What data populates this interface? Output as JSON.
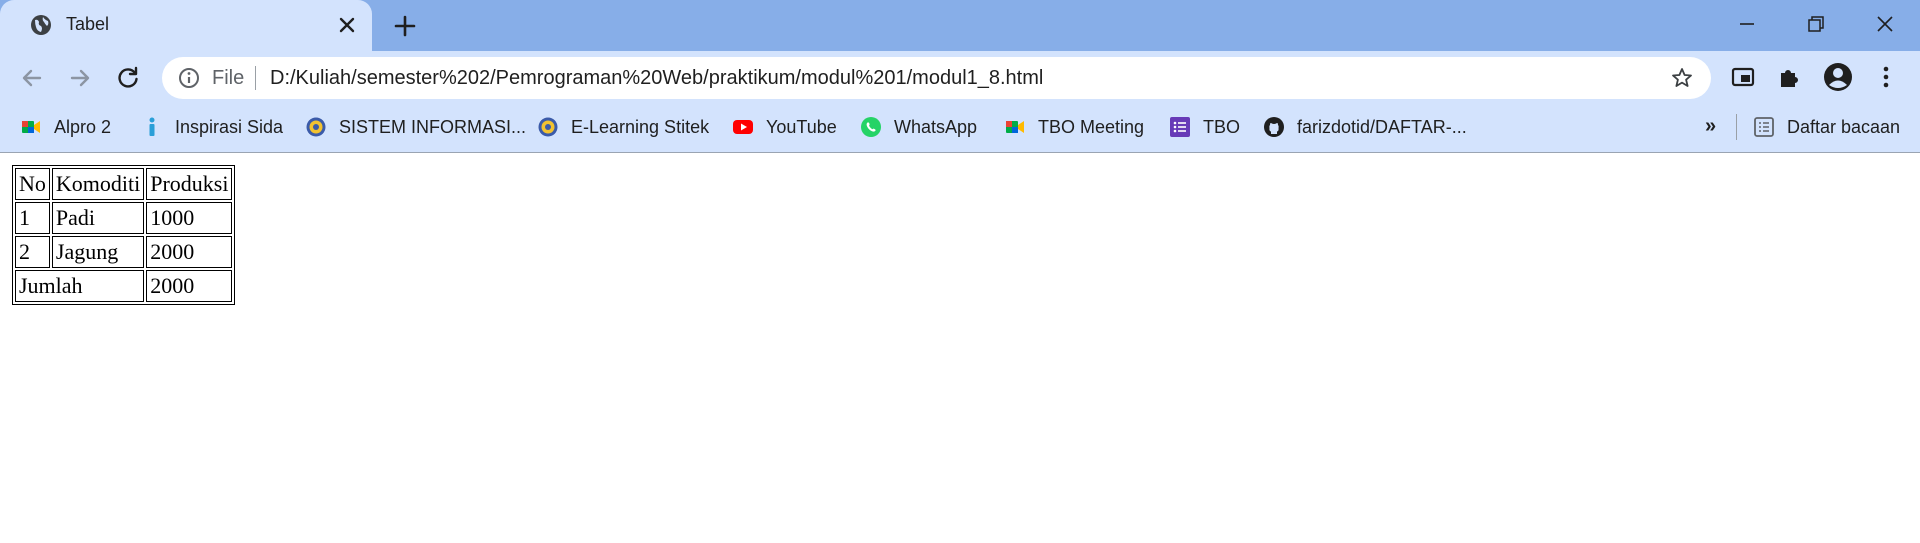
{
  "tab": {
    "title": "Tabel"
  },
  "toolbar": {
    "scheme_label": "File",
    "url": "D:/Kuliah/semester%202/Pemrograman%20Web/praktikum/modul%201/modul1_8.html"
  },
  "bookmarks": {
    "items": [
      {
        "label": "Alpro 2",
        "icon": "google-meet-icon"
      },
      {
        "label": "Inspirasi Sida",
        "icon": "info-figure-icon"
      },
      {
        "label": "SISTEM INFORMASI...",
        "icon": "campus-logo-icon"
      },
      {
        "label": "E-Learning Stitek",
        "icon": "campus-logo-icon"
      },
      {
        "label": "YouTube",
        "icon": "youtube-icon"
      },
      {
        "label": "WhatsApp",
        "icon": "whatsapp-icon"
      },
      {
        "label": "TBO Meeting",
        "icon": "google-meet-icon"
      },
      {
        "label": "TBO",
        "icon": "google-forms-icon"
      },
      {
        "label": "farizdotid/DAFTAR-...",
        "icon": "github-icon"
      }
    ],
    "more_label": "»",
    "reading_list_label": "Daftar bacaan"
  },
  "table": {
    "header": [
      "No",
      "Komoditi",
      "Produksi"
    ],
    "rows": [
      [
        "1",
        "Padi",
        "1000"
      ],
      [
        "2",
        "Jagung",
        "2000"
      ]
    ],
    "total": {
      "label": "Jumlah",
      "value": "2000"
    }
  }
}
